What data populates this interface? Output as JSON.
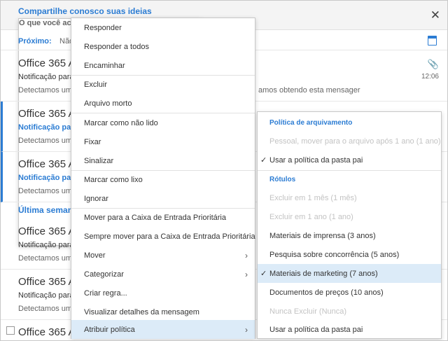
{
  "feedback": {
    "title": "Compartilhe conosco suas ideias",
    "subtitle": "O que você ach",
    "close_icon": "close-icon"
  },
  "next": {
    "label": "Próximo:",
    "value": "Não h"
  },
  "messages": [
    {
      "sender": "Office 365 A",
      "subject": "Notificação para",
      "preview": "Detectamos uma",
      "preview_tail": "amos obtendo esta mensager",
      "time": "12:06",
      "unread": false
    },
    {
      "sender": "Office 365 A",
      "subject": "Notificação par",
      "preview": "Detectamos uma",
      "unread": true
    },
    {
      "sender": "Office 365 A",
      "subject": "Notificação par",
      "preview": "Detectamos uma",
      "unread": true
    },
    {
      "sender": "Office 365 A",
      "subject": "Notificação para",
      "preview": "Detectamos uma",
      "unread": false
    },
    {
      "sender": "Office 365 A",
      "subject": "Notificação para",
      "preview": "Detectamos uma",
      "unread": false
    },
    {
      "sender": "Office 365 A",
      "unread": false
    }
  ],
  "section_header": "Última semana",
  "context_menu": {
    "items": [
      "Responder",
      "Responder a todos",
      "Encaminhar",
      "Excluir",
      "Arquivo morto",
      "Marcar como não lido",
      "Fixar",
      "Sinalizar",
      "Marcar como lixo",
      "Ignorar",
      "Mover para a Caixa de Entrada Prioritária",
      "Sempre mover para a Caixa de Entrada Prioritária",
      "Mover",
      "Categorizar",
      "Criar regra...",
      "Visualizar detalhes da mensagem",
      "Atribuir política"
    ],
    "submenu_arrow": "›"
  },
  "policy_submenu": {
    "archive_header": "Política de arquivamento",
    "archive_items": [
      "Pessoal, mover para o arquivo após 1 ano (1 ano)",
      "Usar a política da pasta pai"
    ],
    "labels_header": "Rótulos",
    "label_items": [
      "Excluir em 1 mês (1 mês)",
      "Excluir em 1 ano (1 ano)",
      "Materiais de imprensa (3 anos)",
      "Pesquisa sobre concorrência (5 anos)",
      "Materiais de marketing (7 anos)",
      "Documentos de preços (10 anos)",
      "Nunca Excluir (Nunca)",
      "Usar a política da pasta pai"
    ],
    "checkmark": "✓"
  },
  "colors": {
    "accent": "#2b7cd3",
    "highlight": "#dcebf8",
    "disabled": "#c3c3c3"
  }
}
